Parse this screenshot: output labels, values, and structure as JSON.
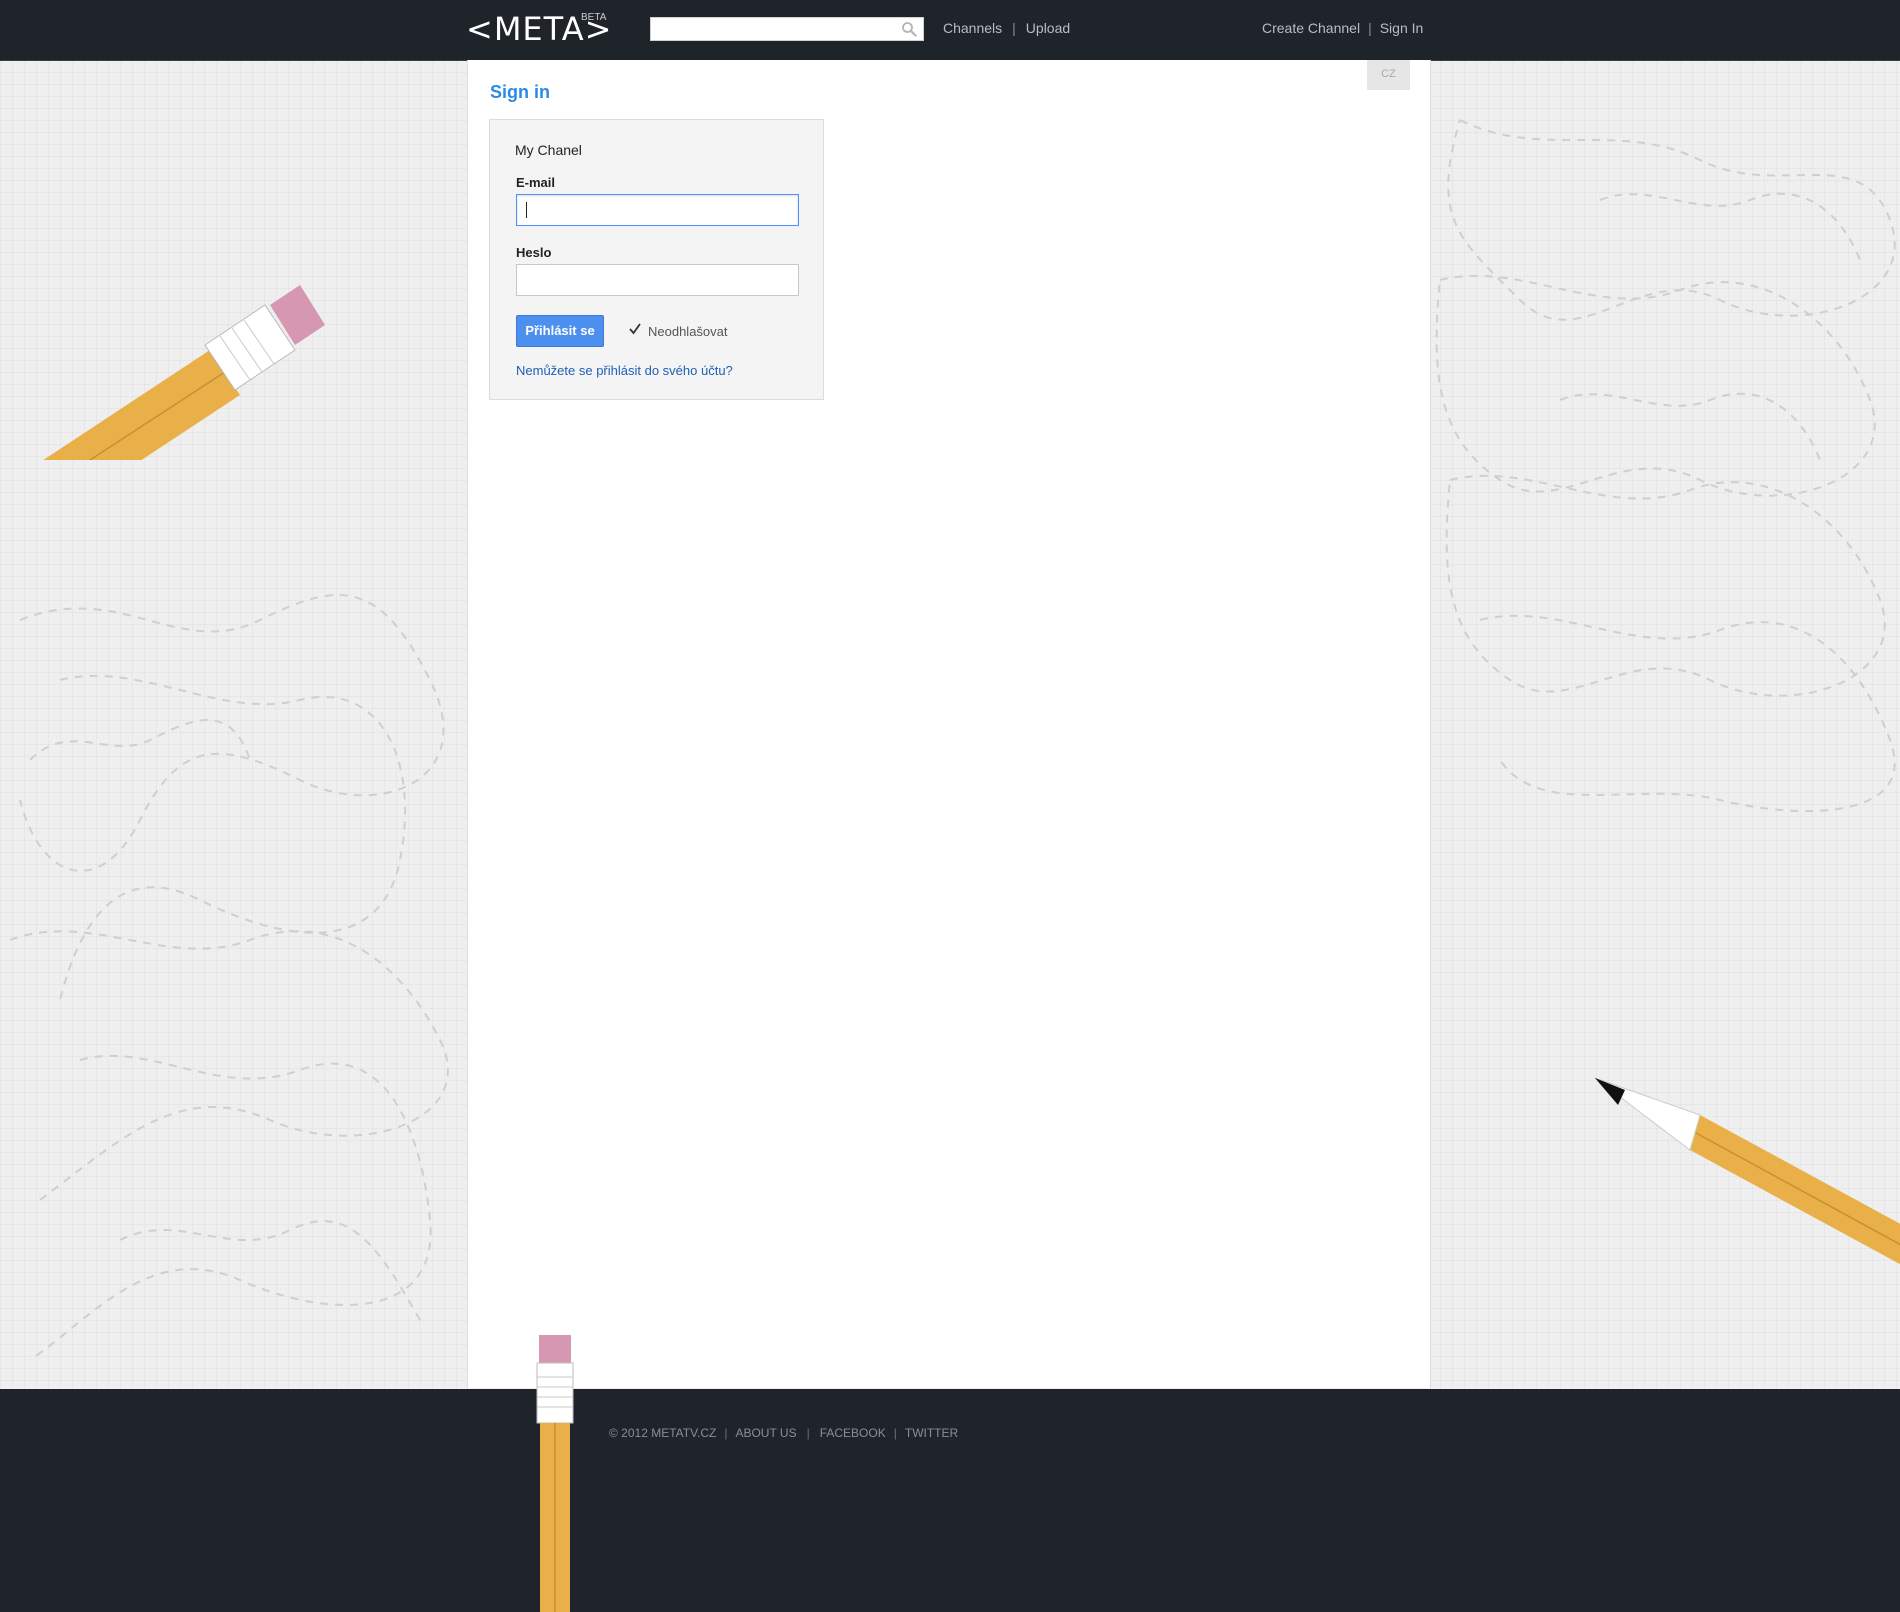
{
  "header": {
    "logo": "<META>",
    "beta": "BETA",
    "search_placeholder": "",
    "nav": {
      "channels": "Channels",
      "upload": "Upload"
    },
    "right": {
      "create_channel": "Create Channel",
      "sign_in": "Sign In"
    },
    "separator": "|"
  },
  "lang": "CZ",
  "main": {
    "title": "Sign in",
    "form": {
      "box_label": "My Chanel",
      "email_label": "E-mail",
      "email_value": "",
      "password_label": "Heslo",
      "password_value": "",
      "submit_label": "Přihlásit se",
      "remember_label": "Neodhlašovat",
      "remember_checked": true,
      "forgot_link": "Nemůžete se přihlásit do svého účtu?"
    }
  },
  "footer": {
    "copyright": "© 2012 METATV.CZ",
    "about": "ABOUT US",
    "facebook": "FACEBOOK",
    "twitter": "TWITTER",
    "separator": "|"
  },
  "colors": {
    "topbar": "#1f232a",
    "accent": "#2a8be6",
    "button": "#4d8fef",
    "link": "#1f5fb4",
    "pencil_body": "#e9b049",
    "eraser": "#d697b2"
  }
}
